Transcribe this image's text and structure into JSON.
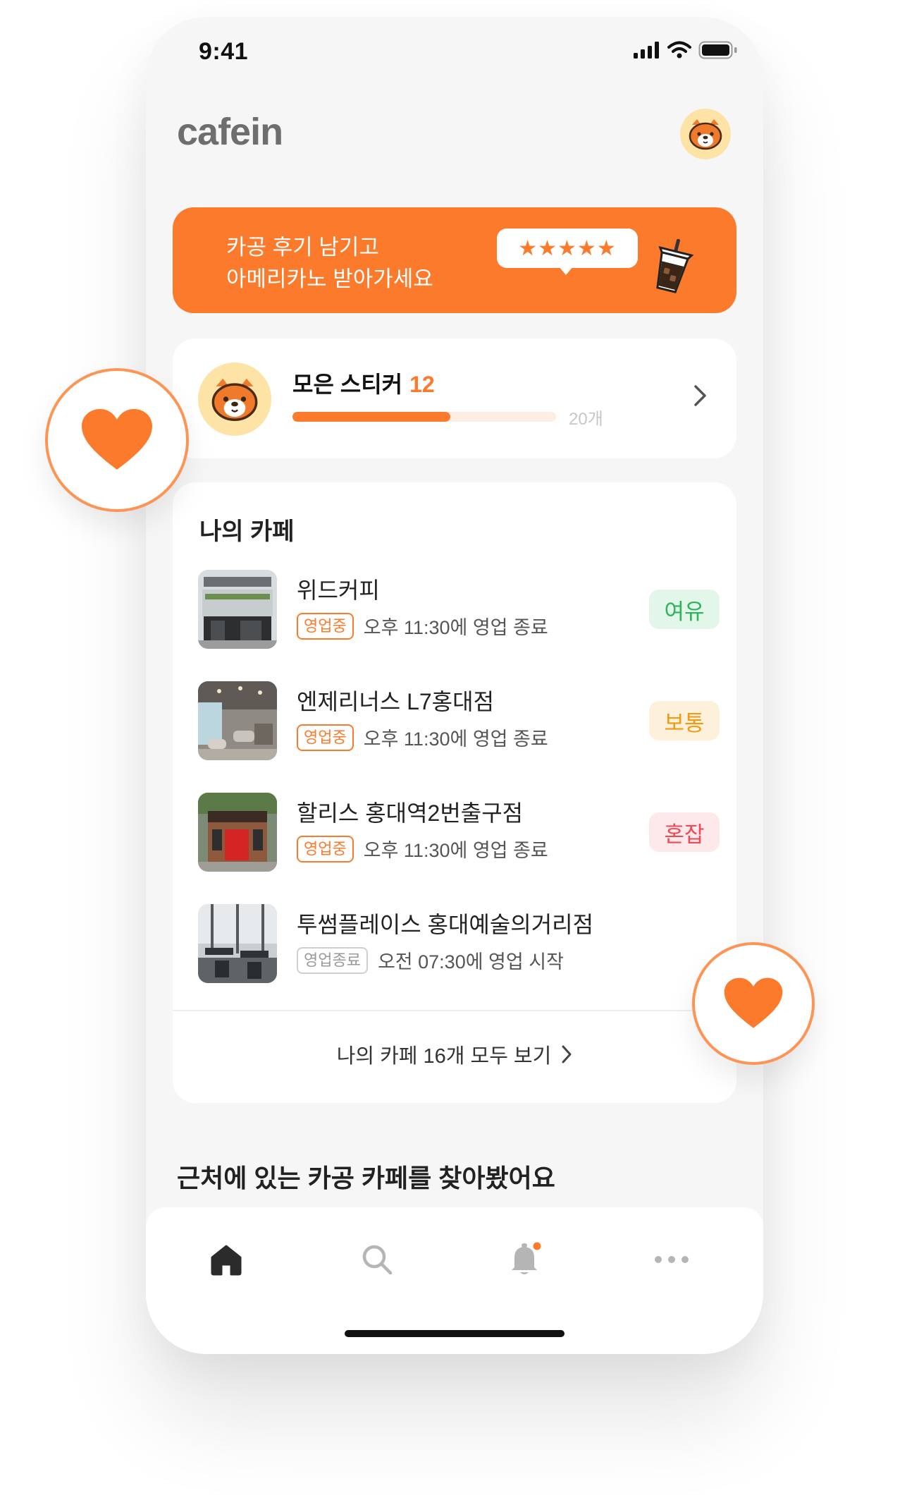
{
  "status_bar": {
    "time": "9:41"
  },
  "header": {
    "logo": "cafein"
  },
  "banner": {
    "line1": "카공 후기 남기고",
    "line2": "아메리카노 받아가세요",
    "stars": "★★★★★"
  },
  "stickers": {
    "label": "모은 스티커",
    "count": "12",
    "max_label": "20개",
    "progress_fraction": 0.6
  },
  "my_cafes": {
    "title": "나의 카페",
    "items": [
      {
        "name": "위드커피",
        "status": "영업중",
        "hours": "오후 11:30에 영업 종료",
        "crowd": "여유"
      },
      {
        "name": "엔제리너스 L7홍대점",
        "status": "영업중",
        "hours": "오후 11:30에 영업 종료",
        "crowd": "보통"
      },
      {
        "name": "할리스 홍대역2번출구점",
        "status": "영업중",
        "hours": "오후 11:30에 영업 종료",
        "crowd": "혼잡"
      },
      {
        "name": "투썸플레이스 홍대예술의거리점",
        "status": "영업종료",
        "hours": "오전 07:30에 영업 시작",
        "crowd": ""
      }
    ],
    "view_all": "나의 카페 16개 모두 보기"
  },
  "nearby": {
    "title": "근처에 있는 카공 카페를 찾아봤어요"
  },
  "colors": {
    "accent": "#fc7a2b",
    "crowd_low_bg": "#e3f6ea",
    "crowd_low_fg": "#2db35d",
    "crowd_mid_bg": "#fdf1dc",
    "crowd_mid_fg": "#f09a14",
    "crowd_high_bg": "#fde8ea",
    "crowd_high_fg": "#ee4a55"
  },
  "icons": {
    "tabs": [
      "home-icon",
      "search-icon",
      "bell-icon",
      "more-icon"
    ],
    "floating": [
      "heart-icon",
      "heart-icon"
    ]
  }
}
